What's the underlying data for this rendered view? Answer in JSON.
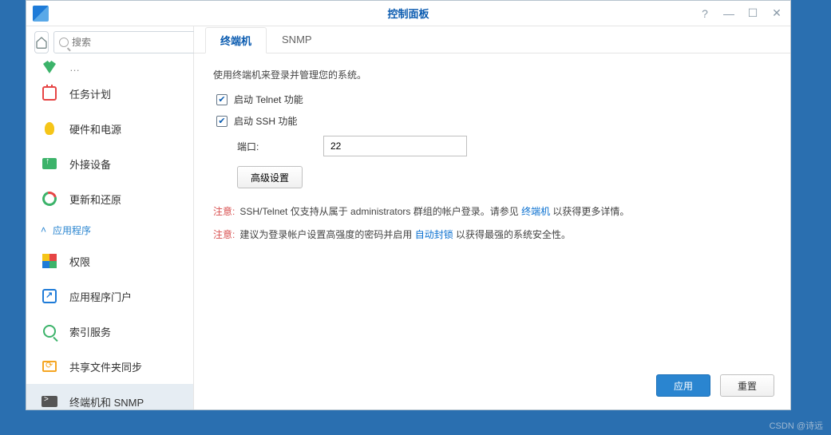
{
  "window": {
    "title": "控制面板"
  },
  "search": {
    "placeholder": "搜索"
  },
  "sidebar": {
    "section_label": "应用程序",
    "items": [
      {
        "label": "任务计划"
      },
      {
        "label": "硬件和电源"
      },
      {
        "label": "外接设备"
      },
      {
        "label": "更新和还原"
      },
      {
        "label": "权限"
      },
      {
        "label": "应用程序门户"
      },
      {
        "label": "索引服务"
      },
      {
        "label": "共享文件夹同步"
      },
      {
        "label": "终端机和 SNMP"
      }
    ]
  },
  "tabs": [
    {
      "label": "终端机",
      "active": true
    },
    {
      "label": "SNMP",
      "active": false
    }
  ],
  "content": {
    "desc": "使用终端机来登录并管理您的系统。",
    "telnet_label": "启动 Telnet 功能",
    "ssh_label": "启动 SSH 功能",
    "port_label": "端口:",
    "port_value": "22",
    "adv_button": "高级设置",
    "note1_label": "注意:",
    "note1_pre": "SSH/Telnet 仅支持从属于 administrators 群组的帐户登录。请参见 ",
    "note1_link": "终端机",
    "note1_post": " 以获得更多详情。",
    "note2_label": "注意:",
    "note2_pre": "建议为登录帐户设置高强度的密码并启用 ",
    "note2_link": "自动封锁",
    "note2_post": " 以获得最强的系统安全性。"
  },
  "buttons": {
    "apply": "应用",
    "reset": "重置"
  },
  "watermark": "CSDN @诗远"
}
